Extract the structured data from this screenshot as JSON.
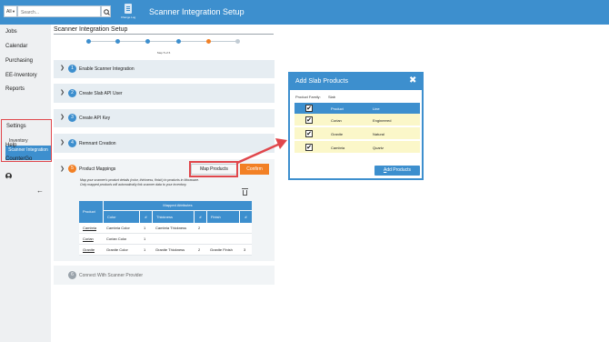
{
  "topbar": {
    "scope_select": "All",
    "search_placeholder": "Search...",
    "changelog_label": "Change Log",
    "app_title": "Scanner Integration Setup"
  },
  "sidebar": {
    "jobs": "Jobs",
    "calendar": "Calendar",
    "purchasing": "Purchasing",
    "ee_inventory": "EE-Inventory",
    "reports": "Reports",
    "settings": "Settings",
    "inventory": "Inventory",
    "scanner_integration": "Scanner Integration",
    "help": "Help",
    "countergo": "CounterGo",
    "back_icon": "←"
  },
  "main": {
    "title": "Scanner Integration Setup",
    "step_text": "Step 5 of 6",
    "steps": [
      {
        "num": "1",
        "title": "Enable Scanner Integration"
      },
      {
        "num": "2",
        "title": "Create Slab API User"
      },
      {
        "num": "3",
        "title": "Create API Key"
      },
      {
        "num": "4",
        "title": "Remnant Creation"
      },
      {
        "num": "5",
        "title": "Product Mappings"
      },
      {
        "num": "6",
        "title": "Connect With Scanner Provider"
      }
    ],
    "map_products_label": "Map Products",
    "confirm_label": "Confirm",
    "note_line1": "Map your scanner's product details (color, thickness, finish) to products in Moraware.",
    "note_line2": "Only mapped products will automatically link scanner data to your inventory.",
    "table": {
      "product_header": "Product",
      "mapped_header": "Mapped Attributes",
      "sub_headers": [
        "Color",
        "#",
        "Thickness",
        "#",
        "Finish",
        "#"
      ],
      "rows": [
        {
          "product": "Cambria",
          "color": "Cambria Color",
          "c_num": "1",
          "thickness": "Cambria Thickness",
          "t_num": "2",
          "finish": "",
          "f_num": ""
        },
        {
          "product": "Corian",
          "color": "Corian Color",
          "c_num": "1",
          "thickness": "",
          "t_num": "",
          "finish": "",
          "f_num": ""
        },
        {
          "product": "Granite",
          "color": "Granite Color",
          "c_num": "1",
          "thickness": "Granite Thickness",
          "t_num": "2",
          "finish": "Granite Finish",
          "f_num": "3"
        }
      ]
    }
  },
  "modal": {
    "title": "Add Slab Products",
    "close_icon": "✖",
    "family_label": "Product Family:",
    "family_value": "Slab",
    "headers": {
      "product": "Product",
      "line": "Line"
    },
    "check_mark": "✔",
    "rows": [
      {
        "product": "Corian",
        "line": "Engineered"
      },
      {
        "product": "Granite",
        "line": "Natural"
      },
      {
        "product": "Cambria",
        "line": "Quartz"
      }
    ],
    "add_button_access": "A",
    "add_button_rest": "dd Products"
  },
  "colors": {
    "primary": "#3d8fce",
    "accent_orange": "#f28025",
    "highlight_red": "#e0474c",
    "modal_row_yellow": "#fbf7c9"
  }
}
